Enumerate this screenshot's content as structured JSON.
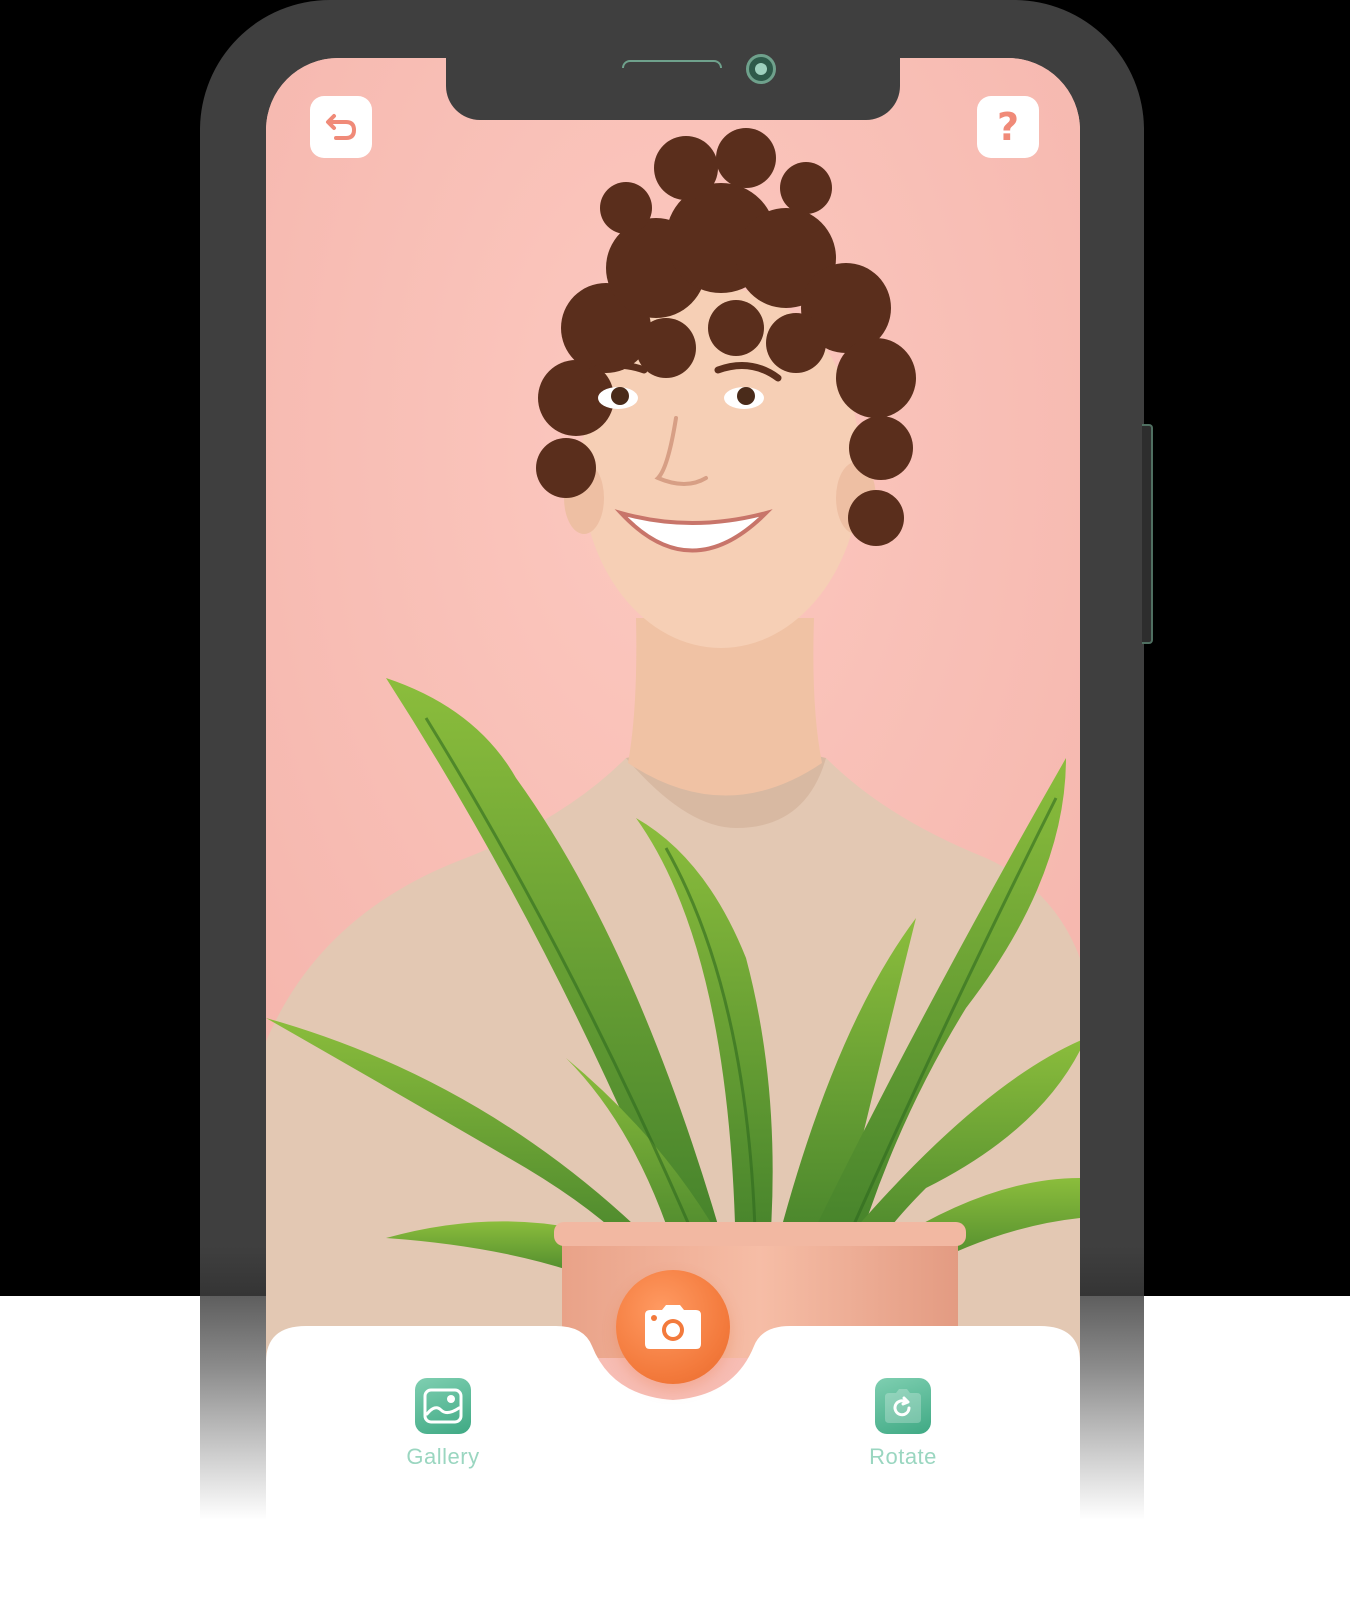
{
  "top_bar": {
    "back_icon": "undo-arrow-icon",
    "help_label": "?"
  },
  "capture": {
    "shutter_icon": "camera-icon"
  },
  "toolbar": {
    "gallery_label": "Gallery",
    "gallery_icon": "image-icon",
    "rotate_label": "Rotate",
    "rotate_icon": "rotate-camera-icon"
  },
  "colors": {
    "screen_background": "#f7bdb4",
    "shutter": "#f37a3c",
    "tool_icon": "#4fb590",
    "tool_label": "#9ad6c0",
    "help_glyph": "#f08a78",
    "phone_frame": "#3f3f3f"
  }
}
